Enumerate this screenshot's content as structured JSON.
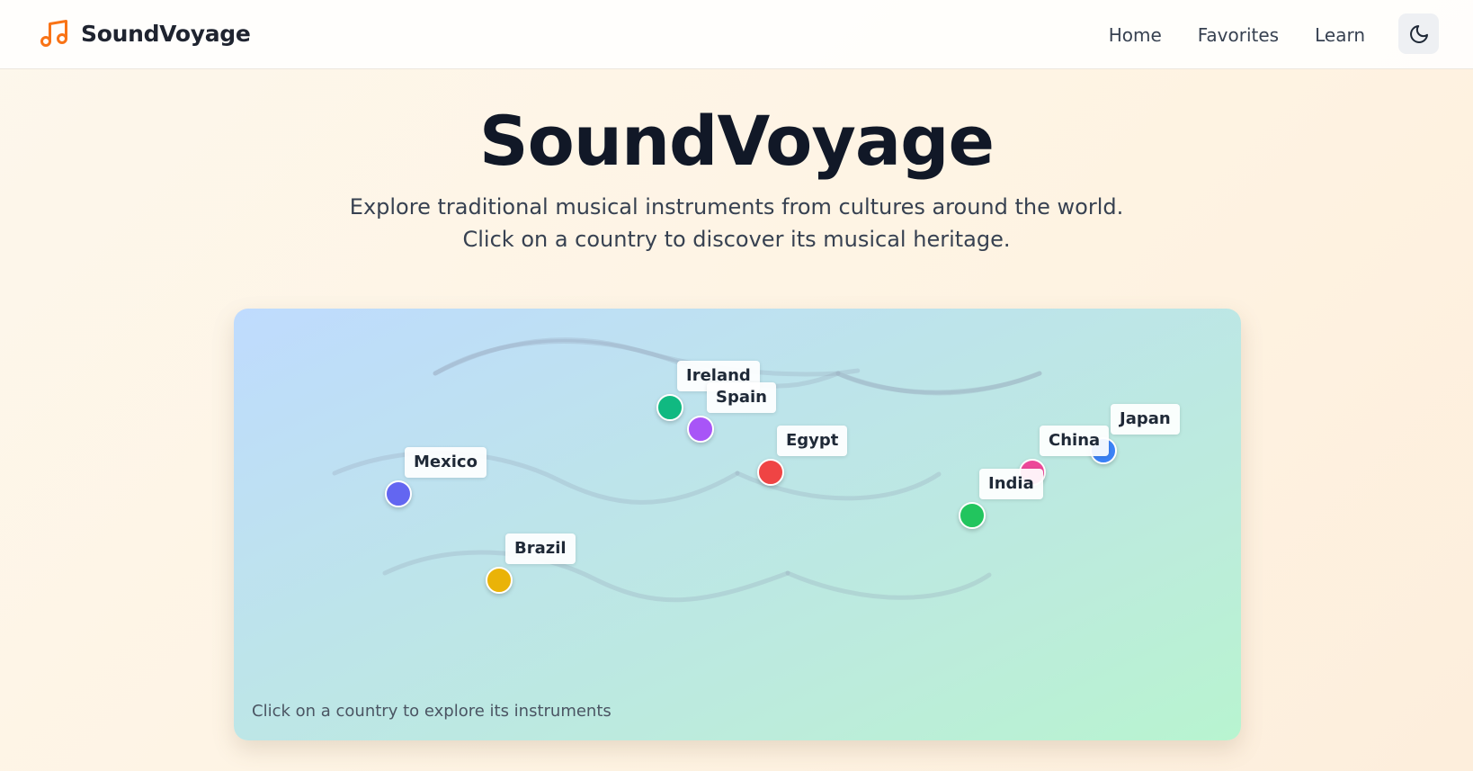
{
  "navbar": {
    "brand_name": "SoundVoyage",
    "brand_icon": "music-note-icon",
    "brand_color": "#f97316",
    "links": [
      "Home",
      "Favorites",
      "Learn"
    ],
    "theme_toggle_icon": "moon-icon"
  },
  "hero": {
    "title": "SoundVoyage",
    "subtitle_line1": "Explore traditional musical instruments from cultures around the world.",
    "subtitle_line2": "Click on a country to discover its musical heritage."
  },
  "map": {
    "hint": "Click on a country to explore its instruments",
    "countries": [
      {
        "name": "Ireland",
        "color": "#10b981"
      },
      {
        "name": "Spain",
        "color": "#a855f7"
      },
      {
        "name": "Egypt",
        "color": "#ef4444"
      },
      {
        "name": "Mexico",
        "color": "#6366f1"
      },
      {
        "name": "Brazil",
        "color": "#eab308"
      },
      {
        "name": "India",
        "color": "#22c55e"
      },
      {
        "name": "China",
        "color": "#ec4899"
      },
      {
        "name": "Japan",
        "color": "#3b82f6"
      }
    ]
  }
}
